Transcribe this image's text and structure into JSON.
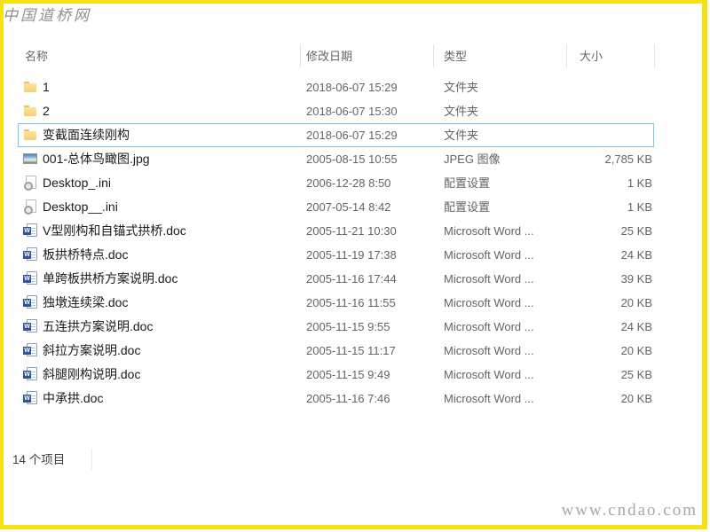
{
  "watermarks": {
    "top_left": "中国道桥网",
    "bottom_right": "www.cndao.com"
  },
  "colors": {
    "frame_yellow": "#F5E211",
    "selection_border_blue": "#7CC3EA",
    "folder_yellow": "#F6CF73",
    "word_blue": "#2B579A",
    "header_text": "#666666",
    "secondary_text": "#646464"
  },
  "columns": [
    {
      "label": "名称"
    },
    {
      "label": "修改日期"
    },
    {
      "label": "类型"
    },
    {
      "label": "大小"
    }
  ],
  "rows": [
    {
      "icon": "folder",
      "name": "1",
      "date": "2018-06-07 15:29",
      "type": "文件夹",
      "size": "",
      "selected": false
    },
    {
      "icon": "folder",
      "name": "2",
      "date": "2018-06-07 15:30",
      "type": "文件夹",
      "size": "",
      "selected": false
    },
    {
      "icon": "folder",
      "name": "变截面连续刚构",
      "date": "2018-06-07 15:29",
      "type": "文件夹",
      "size": "",
      "selected": true
    },
    {
      "icon": "image",
      "name": "001-总体鸟瞰图.jpg",
      "date": "2005-08-15 10:55",
      "type": "JPEG 图像",
      "size": "2,785 KB",
      "selected": false
    },
    {
      "icon": "ini",
      "name": "Desktop_.ini",
      "date": "2006-12-28 8:50",
      "type": "配置设置",
      "size": "1 KB",
      "selected": false
    },
    {
      "icon": "ini",
      "name": "Desktop__.ini",
      "date": "2007-05-14 8:42",
      "type": "配置设置",
      "size": "1 KB",
      "selected": false
    },
    {
      "icon": "word",
      "name": "V型刚构和自锚式拱桥.doc",
      "date": "2005-11-21 10:30",
      "type": "Microsoft Word ...",
      "size": "25 KB",
      "selected": false
    },
    {
      "icon": "word",
      "name": "板拱桥特点.doc",
      "date": "2005-11-19 17:38",
      "type": "Microsoft Word ...",
      "size": "24 KB",
      "selected": false
    },
    {
      "icon": "word",
      "name": "单跨板拱桥方案说明.doc",
      "date": "2005-11-16 17:44",
      "type": "Microsoft Word ...",
      "size": "39 KB",
      "selected": false
    },
    {
      "icon": "word",
      "name": "独墩连续梁.doc",
      "date": "2005-11-16 11:55",
      "type": "Microsoft Word ...",
      "size": "20 KB",
      "selected": false
    },
    {
      "icon": "word",
      "name": "五连拱方案说明.doc",
      "date": "2005-11-15 9:55",
      "type": "Microsoft Word ...",
      "size": "24 KB",
      "selected": false
    },
    {
      "icon": "word",
      "name": "斜拉方案说明.doc",
      "date": "2005-11-15 11:17",
      "type": "Microsoft Word ...",
      "size": "20 KB",
      "selected": false
    },
    {
      "icon": "word",
      "name": "斜腿刚构说明.doc",
      "date": "2005-11-15 9:49",
      "type": "Microsoft Word ...",
      "size": "25 KB",
      "selected": false
    },
    {
      "icon": "word",
      "name": "中承拱.doc",
      "date": "2005-11-16 7:46",
      "type": "Microsoft Word ...",
      "size": "20 KB",
      "selected": false
    }
  ],
  "status_bar": {
    "items_count": "14 个项目"
  }
}
